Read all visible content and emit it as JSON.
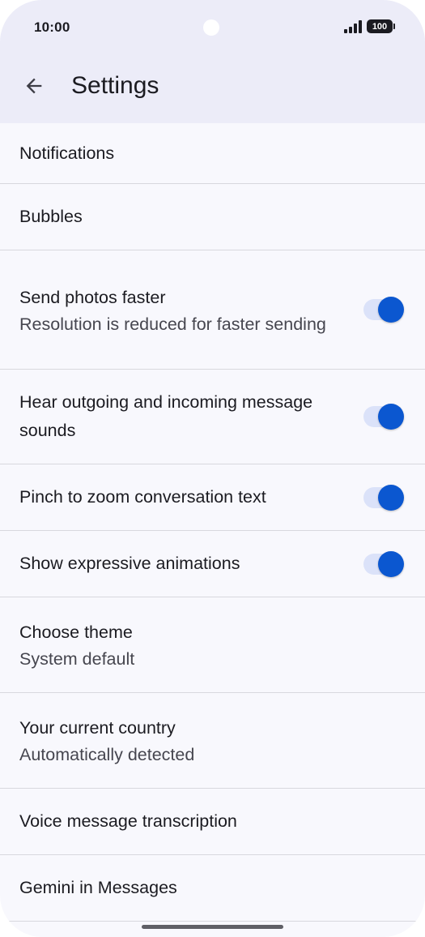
{
  "status_bar": {
    "time": "10:00",
    "battery": "100"
  },
  "app_bar": {
    "title": "Settings"
  },
  "colors": {
    "accent": "#0b57d0",
    "toggle_track": "#dbe2f9",
    "header_bg": "#ececf8"
  },
  "settings": [
    {
      "primary": "Notifications"
    },
    {
      "primary": "Bubbles"
    },
    {
      "primary": "Send photos faster",
      "secondary": "Resolution is reduced for faster sending",
      "toggle": true
    },
    {
      "primary": "Hear outgoing and incoming message sounds",
      "toggle": true
    },
    {
      "primary": "Pinch to zoom conversation text",
      "toggle": true
    },
    {
      "primary": "Show expressive animations",
      "toggle": true
    },
    {
      "primary": "Choose theme",
      "secondary": "System default"
    },
    {
      "primary": "Your current country",
      "secondary": "Automatically detected"
    },
    {
      "primary": "Voice message transcription"
    },
    {
      "primary": "Gemini in Messages"
    }
  ]
}
